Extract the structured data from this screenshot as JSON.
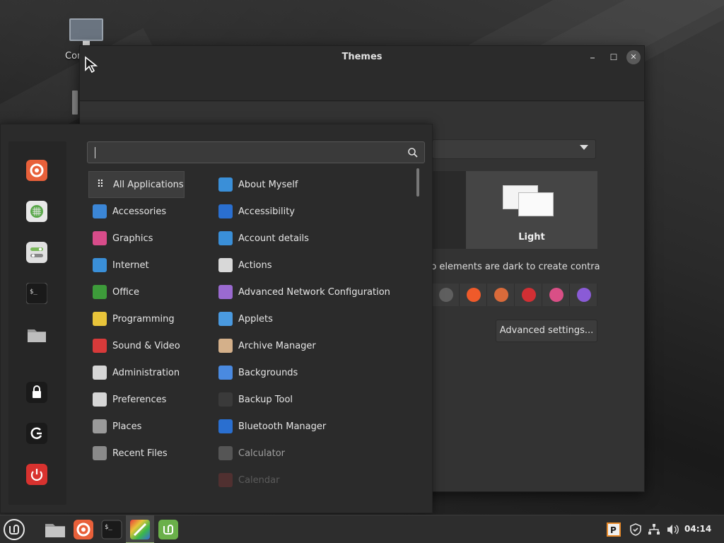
{
  "desktop": {
    "icon_label": "Computer"
  },
  "themes_window": {
    "title": "Themes",
    "minimize": "⎯",
    "maximize": "☐",
    "close": "✕",
    "theme_light_label": "Light",
    "hint_text": "p elements are dark to create contrast.",
    "advanced_button": "Advanced settings...",
    "accent_colors": [
      "#5f5f5f",
      "#ef5a2a",
      "#d96a3a",
      "#d22f34",
      "#d94f86",
      "#8a5bd6"
    ]
  },
  "menu": {
    "search_placeholder": "",
    "categories": [
      {
        "label": "All Applications",
        "icon": "grid-icon",
        "color": "#3d3d3d"
      },
      {
        "label": "Accessories",
        "icon": "scissors-icon",
        "color": "#3b86d6"
      },
      {
        "label": "Graphics",
        "icon": "palette-icon",
        "color": "#d84c8a"
      },
      {
        "label": "Internet",
        "icon": "cloud-icon",
        "color": "#3a8fd8"
      },
      {
        "label": "Office",
        "icon": "office-icon",
        "color": "#3d9b3a"
      },
      {
        "label": "Programming",
        "icon": "code-icon",
        "color": "#e8c43a"
      },
      {
        "label": "Sound & Video",
        "icon": "play-icon",
        "color": "#d83a3a"
      },
      {
        "label": "Administration",
        "icon": "admin-icon",
        "color": "#d6d6d6"
      },
      {
        "label": "Preferences",
        "icon": "preferences-icon",
        "color": "#d6d6d6"
      },
      {
        "label": "Places",
        "icon": "folder-icon",
        "color": "#9a9a9a"
      },
      {
        "label": "Recent Files",
        "icon": "recent-folder-icon",
        "color": "#8a8a8a"
      }
    ],
    "apps": [
      {
        "label": "About Myself",
        "icon": "person-icon",
        "color": "#3a8fd8"
      },
      {
        "label": "Accessibility",
        "icon": "accessibility-icon",
        "color": "#2a6fd0"
      },
      {
        "label": "Account details",
        "icon": "account-icon",
        "color": "#3a8fd8"
      },
      {
        "label": "Actions",
        "icon": "actions-icon",
        "color": "#d8d8d8"
      },
      {
        "label": "Advanced Network Configuration",
        "icon": "network-config-icon",
        "color": "#9a6ad0"
      },
      {
        "label": "Applets",
        "icon": "applets-icon",
        "color": "#4a9ae0"
      },
      {
        "label": "Archive Manager",
        "icon": "archive-icon",
        "color": "#d4b08a"
      },
      {
        "label": "Backgrounds",
        "icon": "backgrounds-icon",
        "color": "#4a8ae0"
      },
      {
        "label": "Backup Tool",
        "icon": "backup-icon",
        "color": "#3a3a3a"
      },
      {
        "label": "Bluetooth Manager",
        "icon": "bluetooth-icon",
        "color": "#2a6fd0"
      },
      {
        "label": "Calculator",
        "icon": "calculator-icon",
        "color": "#555555"
      },
      {
        "label": "Calendar",
        "icon": "calendar-icon",
        "color": "#c04040"
      }
    ]
  },
  "taskbar": {
    "clock": "04:14"
  }
}
